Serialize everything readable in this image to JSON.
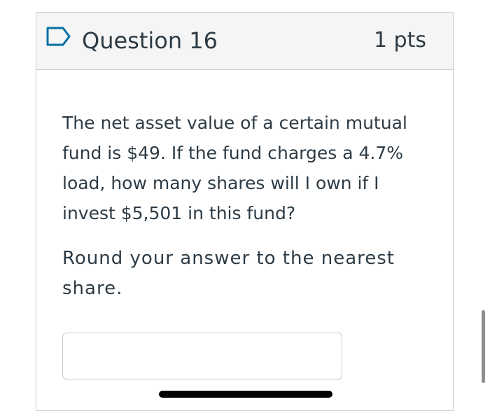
{
  "question": {
    "title": "Question 16",
    "points": "1 pts",
    "flag_icon": "bookmark-flag-icon",
    "body": "The net asset value of a certain mutual fund is $49. If the fund charges a 4.7% load, how many shares will I own if I invest $5,501 in this fund?",
    "instruction": "Round your answer to the nearest share.",
    "answer_value": "",
    "answer_placeholder": ""
  },
  "colors": {
    "text": "#2d3b45",
    "header_bg": "#f5f5f5",
    "border": "#c7cdd1",
    "flag_accent": "#0770a3"
  }
}
